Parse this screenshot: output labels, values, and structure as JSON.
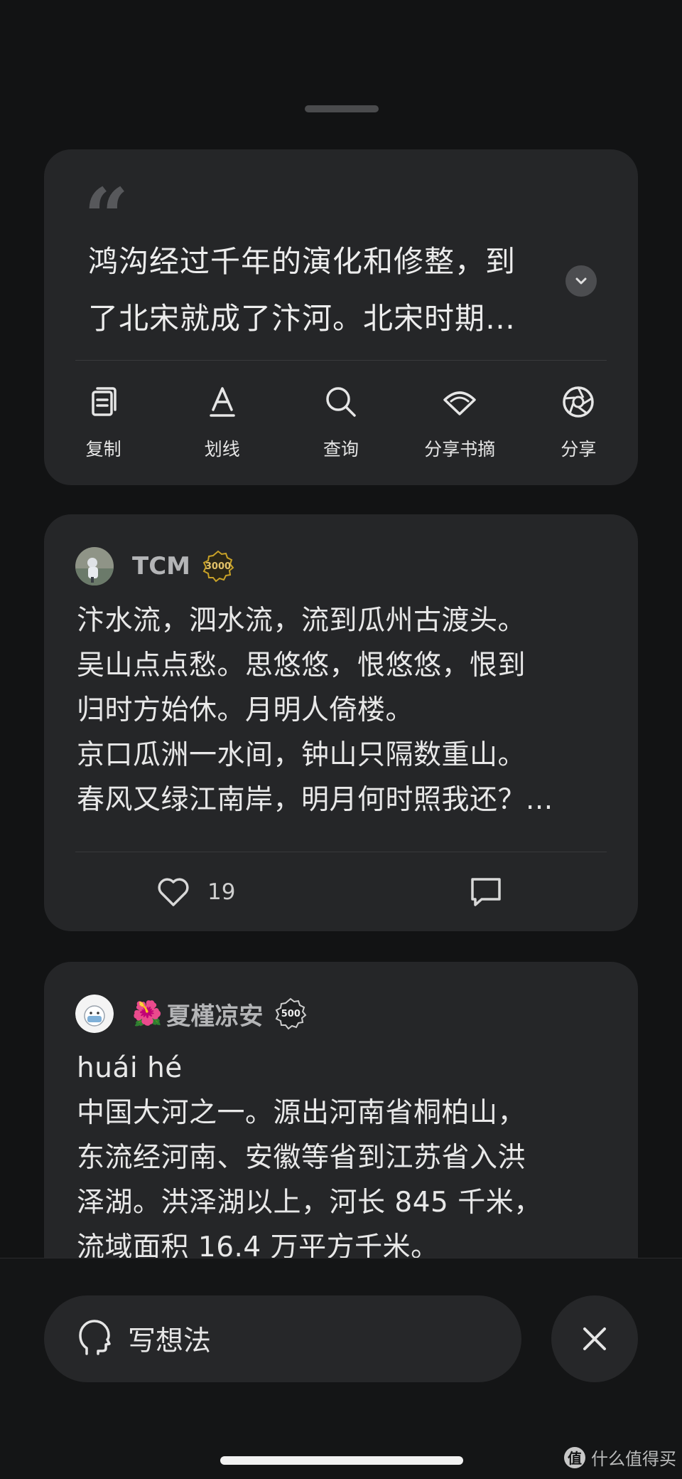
{
  "quote": {
    "text": "鸿沟经过千年的演化和修整，到了北宋就成了汴河。北宋时期…"
  },
  "actions": [
    {
      "label": "复制",
      "icon": "copy-icon"
    },
    {
      "label": "划线",
      "icon": "underline-icon"
    },
    {
      "label": "查询",
      "icon": "search-icon"
    },
    {
      "label": "分享书摘",
      "icon": "share-excerpt-icon"
    },
    {
      "label": "分享",
      "icon": "share-icon"
    }
  ],
  "comments": [
    {
      "username": "TCM",
      "badge": "3000",
      "text": "汴水流，泗水流，流到瓜州古渡头。\n吴山点点愁。思悠悠，恨悠悠，恨到\n归时方始休。月明人倚楼。\n京口瓜洲一水间，钟山只隔数重山。\n春风又绿江南岸，明月何时照我还？...",
      "likes": "19"
    },
    {
      "emoji": "🌺",
      "username": "夏槿凉安",
      "badge": "500",
      "text": "huái hé\n中国大河之一。源出河南省桐柏山，\n东流经河南、安徽等省到江苏省入洪\n泽湖。洪泽湖以上，河长 845 千米，\n流域面积 16.4 万平方千米。"
    }
  ],
  "bottom": {
    "write_label": "写想法"
  },
  "watermark": {
    "logo": "值",
    "text": "什么值得买"
  },
  "colors": {
    "background": "#121314",
    "card": "#252628",
    "badge_gold": "#c9a227"
  }
}
